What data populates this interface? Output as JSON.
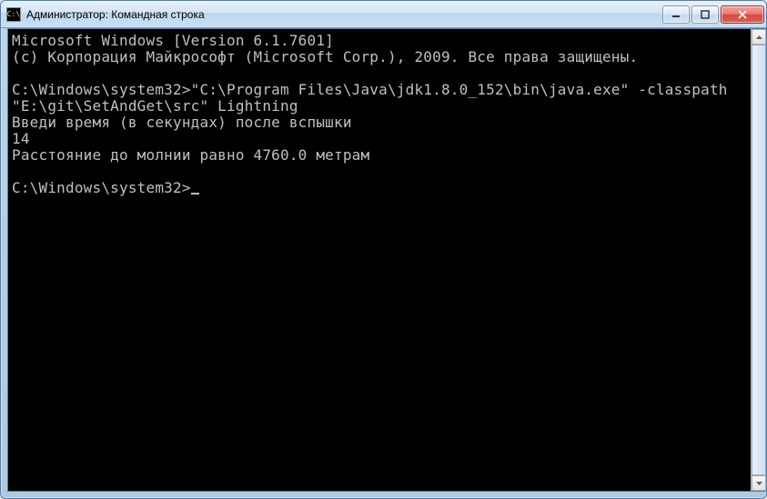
{
  "window": {
    "title": "Администратор: Командная строка"
  },
  "terminal": {
    "line1": "Microsoft Windows [Version 6.1.7601]",
    "line2": "(c) Корпорация Майкрософт (Microsoft Corp.), 2009. Все права защищены.",
    "blank1": "",
    "line3": "C:\\Windows\\system32>\"C:\\Program Files\\Java\\jdk1.8.0_152\\bin\\java.exe\" -classpath \"E:\\git\\SetAndGet\\src\" Lightning",
    "line4": "Введи время (в секундах) после вспышки",
    "line5": "14",
    "line6": "Расстояние до молнии равно 4760.0 метрам",
    "blank2": "",
    "prompt": "C:\\Windows\\system32>"
  }
}
